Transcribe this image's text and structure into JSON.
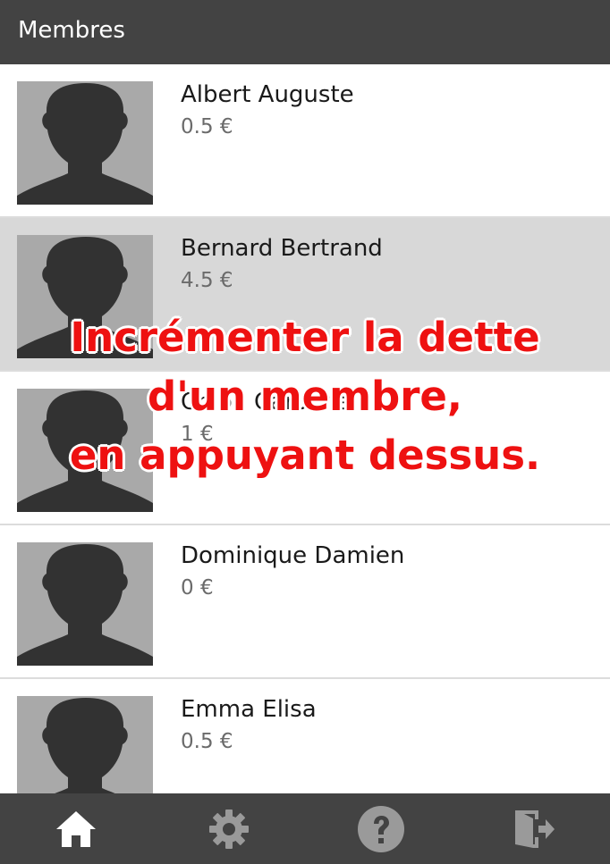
{
  "app_bar": {
    "title": "Membres"
  },
  "members": [
    {
      "name": "Albert Auguste",
      "debt": "0.5 €",
      "pressed": false
    },
    {
      "name": "Bernard Bertrand",
      "debt": "4.5 €",
      "pressed": true
    },
    {
      "name": "Chloé Caroline",
      "debt": "1 €",
      "pressed": false
    },
    {
      "name": "Dominique Damien",
      "debt": "0 €",
      "pressed": false
    },
    {
      "name": "Emma Elisa",
      "debt": "0.5 €",
      "pressed": false
    }
  ],
  "overlay": {
    "lines": [
      "Incrémenter la dette",
      "d'un membre,",
      "en appuyant dessus."
    ]
  },
  "bottom_nav": {
    "items": [
      {
        "icon": "home-icon",
        "active": true
      },
      {
        "icon": "gear-icon",
        "active": false
      },
      {
        "icon": "help-icon",
        "active": false
      },
      {
        "icon": "exit-icon",
        "active": false
      }
    ]
  },
  "colors": {
    "app_bar": "#434343",
    "pressed_row": "#d8d8d8",
    "avatar_bg": "#a9a9a9",
    "avatar_silhouette": "#323232",
    "overlay_text": "#ee1111",
    "nav_active": "#ffffff",
    "nav_inactive": "#9a9a9a"
  }
}
